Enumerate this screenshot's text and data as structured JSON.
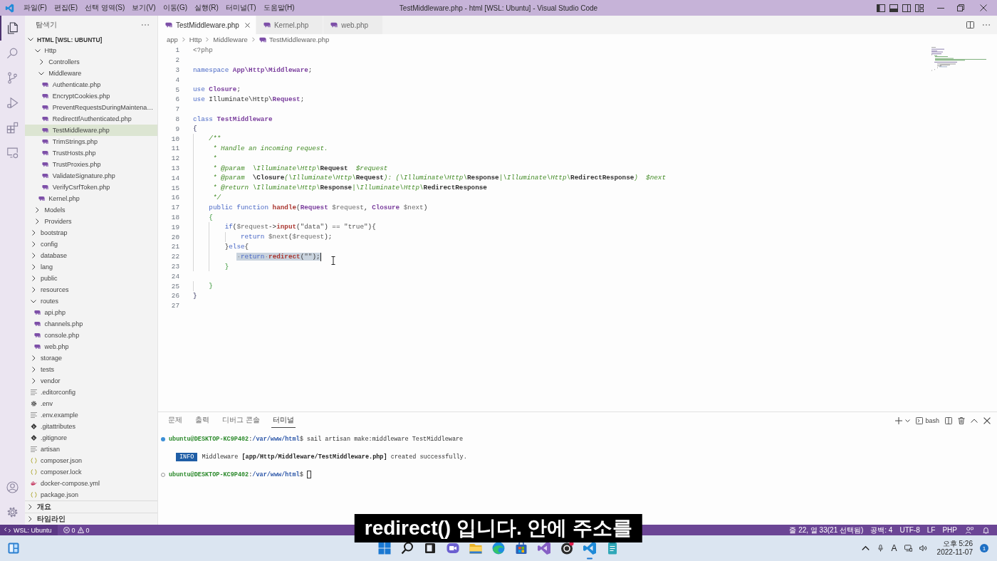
{
  "title_bar": {
    "menus": [
      "파일(F)",
      "편집(E)",
      "선택 영역(S)",
      "보기(V)",
      "이동(G)",
      "실행(R)",
      "터미널(T)",
      "도움말(H)"
    ],
    "title": "TestMiddleware.php - html [WSL: Ubuntu] - Visual Studio Code",
    "layout_toggles": [
      {
        "kind": "primary-sidebar",
        "on": true
      },
      {
        "kind": "panel",
        "on": true
      },
      {
        "kind": "secondary-sidebar",
        "on": false
      },
      {
        "kind": "customize",
        "on": false
      }
    ]
  },
  "activity_bar": {
    "top": [
      {
        "kind": "explorer",
        "selected": true
      },
      {
        "kind": "search",
        "selected": false
      },
      {
        "kind": "source-control",
        "selected": false
      },
      {
        "kind": "run-debug",
        "selected": false
      },
      {
        "kind": "extensions",
        "selected": false
      },
      {
        "kind": "remote-explorer",
        "selected": false
      }
    ],
    "bottom": [
      {
        "kind": "accounts",
        "selected": false
      },
      {
        "kind": "manage",
        "selected": false
      }
    ]
  },
  "explorer": {
    "title": "탐색기",
    "root": {
      "label": "HTML [WSL: UBUNTU]",
      "expanded": true
    },
    "scrolled_branch": [
      {
        "label": "Http",
        "kind": "folder",
        "expanded": true,
        "selected": false,
        "children": [
          {
            "label": "Controllers",
            "kind": "folder",
            "expanded": false,
            "selected": false
          },
          {
            "label": "Middleware",
            "kind": "folder",
            "expanded": true,
            "selected": false,
            "children": [
              {
                "label": "Authenticate.php",
                "kind": "php",
                "selected": false
              },
              {
                "label": "EncryptCookies.php",
                "kind": "php",
                "selected": false
              },
              {
                "label": "PreventRequestsDuringMaintena…",
                "kind": "php",
                "selected": false
              },
              {
                "label": "RedirectIfAuthenticated.php",
                "kind": "php",
                "selected": false
              },
              {
                "label": "TestMiddleware.php",
                "kind": "php",
                "selected": true
              },
              {
                "label": "TrimStrings.php",
                "kind": "php",
                "selected": false
              },
              {
                "label": "TrustHosts.php",
                "kind": "php",
                "selected": false
              },
              {
                "label": "TrustProxies.php",
                "kind": "php",
                "selected": false
              },
              {
                "label": "ValidateSignature.php",
                "kind": "php",
                "selected": false
              },
              {
                "label": "VerifyCsrfToken.php",
                "kind": "php",
                "selected": false
              }
            ]
          },
          {
            "label": "Kernel.php",
            "kind": "php",
            "selected": false
          }
        ]
      },
      {
        "label": "Models",
        "kind": "folder",
        "expanded": false,
        "selected": false
      },
      {
        "label": "Providers",
        "kind": "folder",
        "expanded": false,
        "selected": false
      }
    ],
    "items": [
      {
        "label": "bootstrap",
        "kind": "folder",
        "expanded": false,
        "selected": false
      },
      {
        "label": "config",
        "kind": "folder",
        "expanded": false,
        "selected": false
      },
      {
        "label": "database",
        "kind": "folder",
        "expanded": false,
        "selected": false
      },
      {
        "label": "lang",
        "kind": "folder",
        "expanded": false,
        "selected": false
      },
      {
        "label": "public",
        "kind": "folder",
        "expanded": false,
        "selected": false
      },
      {
        "label": "resources",
        "kind": "folder",
        "expanded": false,
        "selected": false
      },
      {
        "label": "routes",
        "kind": "folder",
        "expanded": true,
        "selected": false,
        "children": [
          {
            "label": "api.php",
            "kind": "php",
            "selected": false
          },
          {
            "label": "channels.php",
            "kind": "php",
            "selected": false
          },
          {
            "label": "console.php",
            "kind": "php",
            "selected": false
          },
          {
            "label": "web.php",
            "kind": "php",
            "selected": false
          }
        ]
      },
      {
        "label": "storage",
        "kind": "folder",
        "expanded": false,
        "selected": false
      },
      {
        "label": "tests",
        "kind": "folder",
        "expanded": false,
        "selected": false
      },
      {
        "label": "vendor",
        "kind": "folder",
        "expanded": false,
        "selected": false
      },
      {
        "label": ".editorconfig",
        "kind": "text",
        "selected": false
      },
      {
        "label": ".env",
        "kind": "settings",
        "selected": false
      },
      {
        "label": ".env.example",
        "kind": "text",
        "selected": false
      },
      {
        "label": ".gitattributes",
        "kind": "git",
        "selected": false
      },
      {
        "label": ".gitignore",
        "kind": "git",
        "selected": false
      },
      {
        "label": "artisan",
        "kind": "text",
        "selected": false
      },
      {
        "label": "composer.json",
        "kind": "json",
        "selected": false
      },
      {
        "label": "composer.lock",
        "kind": "json",
        "selected": false
      },
      {
        "label": "docker-compose.yml",
        "kind": "docker",
        "selected": false
      },
      {
        "label": "package.json",
        "kind": "json",
        "selected": false
      }
    ],
    "sections": [
      {
        "label": "개요",
        "expanded": false
      },
      {
        "label": "타임라인",
        "expanded": false
      }
    ]
  },
  "editor": {
    "tabs": [
      {
        "label": "TestMiddleware.php",
        "selected": true
      },
      {
        "label": "Kernel.php",
        "selected": false
      },
      {
        "label": "web.php",
        "selected": false
      }
    ],
    "breadcrumb": [
      {
        "label": "app",
        "kind": "folder"
      },
      {
        "label": "Http",
        "kind": "folder"
      },
      {
        "label": "Middleware",
        "kind": "folder"
      },
      {
        "label": "TestMiddleware.php",
        "kind": "php"
      }
    ],
    "lines": [
      {
        "number": "1",
        "tokens": [
          {
            "kind": "tag",
            "text": "<?php"
          }
        ]
      },
      {
        "number": "2"
      },
      {
        "number": "3",
        "tokens": [
          {
            "kind": "keyword",
            "text": "namespace "
          },
          {
            "kind": "type",
            "text": "App\\Http\\Middleware"
          },
          {
            "kind": "plain",
            "text": ";"
          }
        ]
      },
      {
        "number": "4"
      },
      {
        "number": "5",
        "tokens": [
          {
            "kind": "keyword",
            "text": "use "
          },
          {
            "kind": "type",
            "text": "Closure"
          },
          {
            "kind": "plain",
            "text": ";"
          }
        ]
      },
      {
        "number": "6",
        "tokens": [
          {
            "kind": "keyword",
            "text": "use "
          },
          {
            "kind": "plain",
            "text": "Illuminate\\Http\\"
          },
          {
            "kind": "type",
            "text": "Request"
          },
          {
            "kind": "plain",
            "text": ";"
          }
        ]
      },
      {
        "number": "7"
      },
      {
        "number": "8",
        "tokens": [
          {
            "kind": "keyword",
            "text": "class "
          },
          {
            "kind": "type",
            "text": "TestMiddleware"
          }
        ]
      },
      {
        "number": "9",
        "tokens": [
          {
            "kind": "bracket",
            "text": "{"
          }
        ]
      },
      {
        "number": "10",
        "tokens": [
          {
            "kind": "comment",
            "text": "    /**"
          }
        ]
      },
      {
        "number": "11",
        "tokens": [
          {
            "kind": "comment",
            "text": "     * Handle an incoming request."
          }
        ]
      },
      {
        "number": "12",
        "tokens": [
          {
            "kind": "comment",
            "text": "     *"
          }
        ]
      },
      {
        "number": "13",
        "tokens": [
          {
            "kind": "comment",
            "text": "     * @param  \\Illuminate\\Http\\"
          },
          {
            "kind": "doc-type",
            "text": "Request"
          },
          {
            "kind": "comment",
            "text": "  $request"
          }
        ]
      },
      {
        "number": "14",
        "tokens": [
          {
            "kind": "comment",
            "text": "     * @param  "
          },
          {
            "kind": "doc-type",
            "text": "\\Closure"
          },
          {
            "kind": "comment",
            "text": "(\\Illuminate\\Http\\"
          },
          {
            "kind": "doc-type",
            "text": "Request"
          },
          {
            "kind": "comment",
            "text": "): (\\Illuminate\\Http\\"
          },
          {
            "kind": "doc-type",
            "text": "Response"
          },
          {
            "kind": "comment",
            "text": "|\\Illuminate\\Http\\"
          },
          {
            "kind": "doc-type",
            "text": "RedirectResponse"
          },
          {
            "kind": "comment",
            "text": ")  $next"
          }
        ]
      },
      {
        "number": "15",
        "tokens": [
          {
            "kind": "comment",
            "text": "     * @return \\Illuminate\\Http\\"
          },
          {
            "kind": "doc-type",
            "text": "Response"
          },
          {
            "kind": "comment",
            "text": "|\\Illuminate\\Http\\"
          },
          {
            "kind": "doc-type",
            "text": "RedirectResponse"
          }
        ]
      },
      {
        "number": "16",
        "tokens": [
          {
            "kind": "comment",
            "text": "     */"
          }
        ]
      },
      {
        "number": "17",
        "tokens": [
          {
            "kind": "keyword",
            "text": "    public function "
          },
          {
            "kind": "function",
            "text": "handle"
          },
          {
            "kind": "plain",
            "text": "("
          },
          {
            "kind": "type",
            "text": "Request"
          },
          {
            "kind": "variable",
            "text": " $request"
          },
          {
            "kind": "plain",
            "text": ", "
          },
          {
            "kind": "type",
            "text": "Closure"
          },
          {
            "kind": "variable",
            "text": " $next"
          },
          {
            "kind": "plain",
            "text": ")"
          }
        ]
      },
      {
        "number": "18",
        "tokens": [
          {
            "kind": "bracket-inner",
            "text": "    {"
          }
        ]
      },
      {
        "number": "19",
        "tokens": [
          {
            "kind": "keyword",
            "text": "        if"
          },
          {
            "kind": "plain",
            "text": "("
          },
          {
            "kind": "variable",
            "text": "$request"
          },
          {
            "kind": "plain",
            "text": "->"
          },
          {
            "kind": "function",
            "text": "input"
          },
          {
            "kind": "plain",
            "text": "("
          },
          {
            "kind": "string",
            "text": "\"data\""
          },
          {
            "kind": "plain",
            "text": ") == "
          },
          {
            "kind": "string",
            "text": "\"true\""
          },
          {
            "kind": "plain",
            "text": "){"
          }
        ]
      },
      {
        "number": "20",
        "tokens": [
          {
            "kind": "keyword",
            "text": "            return "
          },
          {
            "kind": "variable",
            "text": "$next"
          },
          {
            "kind": "plain",
            "text": "("
          },
          {
            "kind": "variable",
            "text": "$request"
          },
          {
            "kind": "plain",
            "text": ");"
          }
        ]
      },
      {
        "number": "21",
        "tokens": [
          {
            "kind": "plain",
            "text": "        }"
          },
          {
            "kind": "keyword",
            "text": "else"
          },
          {
            "kind": "plain",
            "text": "{"
          }
        ]
      },
      {
        "number": "22",
        "selection": [
          {
            "kind": "whitespace",
            "text": "           ·"
          },
          {
            "kind": "keyword",
            "text": "return"
          },
          {
            "kind": "whitespace",
            "text": "·"
          },
          {
            "kind": "function",
            "text": "redirect"
          },
          {
            "kind": "plain",
            "text": "("
          },
          {
            "kind": "string",
            "text": "\"\""
          },
          {
            "kind": "plain",
            "text": ");"
          }
        ]
      },
      {
        "number": "23",
        "tokens": [
          {
            "kind": "bracket-inner",
            "text": "        }"
          }
        ]
      },
      {
        "number": "24"
      },
      {
        "number": "25",
        "tokens": [
          {
            "kind": "bracket-inner",
            "text": "    }"
          }
        ]
      },
      {
        "number": "26",
        "tokens": [
          {
            "kind": "bracket",
            "text": "}"
          }
        ]
      },
      {
        "number": "27"
      }
    ]
  },
  "panel": {
    "tabs": [
      {
        "label": "문제",
        "selected": false
      },
      {
        "label": "출력",
        "selected": false
      },
      {
        "label": "디버그 콘솔",
        "selected": false
      },
      {
        "label": "터미널",
        "selected": true
      }
    ],
    "terminal_name": "bash",
    "terminal_lines": [
      {
        "kind": "command",
        "segments": [
          {
            "kind": "user",
            "text": "ubuntu@DESKTOP-KC9P402"
          },
          {
            "kind": "plain",
            "text": ":"
          },
          {
            "kind": "path",
            "text": "/var/www/html"
          },
          {
            "kind": "plain",
            "text": "$ sail artisan make:middleware TestMiddleware"
          }
        ]
      },
      {
        "kind": "output",
        "segments": [
          {
            "kind": "badge",
            "text": "INFO"
          },
          {
            "kind": "plain",
            "text": "Middleware "
          },
          {
            "kind": "bold",
            "text": "[app/Http/Middleware/TestMiddleware.php]"
          },
          {
            "kind": "plain",
            "text": " created successfully."
          }
        ]
      },
      {
        "kind": "prompt",
        "segments": [
          {
            "kind": "user",
            "text": "ubuntu@DESKTOP-KC9P402"
          },
          {
            "kind": "plain",
            "text": ":"
          },
          {
            "kind": "path",
            "text": "/var/www/html"
          },
          {
            "kind": "plain",
            "text": "$"
          }
        ]
      }
    ]
  },
  "status_bar": {
    "remote": "WSL: Ubuntu",
    "errors": "0",
    "warnings": "0",
    "items": [
      "줄 22, 열 33(21 선택됨)",
      "공백: 4",
      "UTF-8",
      "LF",
      "PHP"
    ]
  },
  "taskbar": {
    "apps": [
      {
        "kind": "start",
        "active": false
      },
      {
        "kind": "search",
        "active": false
      },
      {
        "kind": "taskview",
        "active": false
      },
      {
        "kind": "chat",
        "active": false
      },
      {
        "kind": "files",
        "active": false
      },
      {
        "kind": "browser",
        "active": false
      },
      {
        "kind": "store",
        "active": false
      },
      {
        "kind": "ide",
        "active": false
      },
      {
        "kind": "recorder",
        "active": false
      },
      {
        "kind": "editor",
        "active": true
      },
      {
        "kind": "notepad",
        "active": false
      }
    ],
    "input_indicator": "A",
    "time": "오후 5:26",
    "date": "2022-11-07",
    "notifications": "1"
  },
  "subtitle": "redirect() 입니다. 안에 주소를"
}
